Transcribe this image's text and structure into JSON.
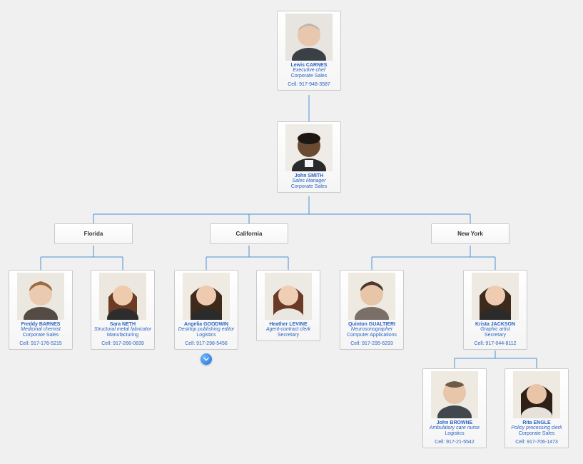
{
  "root": {
    "name": "Lewis CARNES",
    "role": "Executive chef",
    "dept": "Corporate Sales",
    "cell": "Cell: 917-948-3587"
  },
  "manager": {
    "name": "John SMITH",
    "role": "Sales Manager",
    "dept": "Corporate Sales"
  },
  "regions": {
    "florida": {
      "label": "Florida"
    },
    "california": {
      "label": "California"
    },
    "newyork": {
      "label": "New York"
    }
  },
  "people": {
    "freddy": {
      "name": "Freddy BARNES",
      "role": "Medicinal chemist",
      "dept": "Corporate Sales",
      "cell": "Cell: 917-176-5215"
    },
    "sara": {
      "name": "Sara NETH",
      "role": "Structural metal fabricator",
      "dept": "Manufacturing",
      "cell": "Cell: 917-266-0839"
    },
    "angelia": {
      "name": "Angelia GOODWIN",
      "role": "Desktop publishing editor",
      "dept": "Logistics",
      "cell": "Cell: 917-298-5456"
    },
    "heather": {
      "name": "Heather LEVINE",
      "role": "Agent-contract clerk",
      "dept": "Secretary"
    },
    "quinton": {
      "name": "Quinton GUALTIERI",
      "role": "Neurosonographer",
      "dept": "Computer Applications",
      "cell": "Cell: 917-295-6293"
    },
    "krista": {
      "name": "Krista JACKSON",
      "role": "Graphic artist",
      "dept": "Secretary",
      "cell": "Cell: 917-044-8112"
    },
    "john": {
      "name": "John BROWNE",
      "role": "Ambulatory care nurse",
      "dept": "Logistics",
      "cell": "Cell: 917-21-5542"
    },
    "rita": {
      "name": "Rita ENGLE",
      "role": "Policy processing clerk",
      "dept": "Corporate Sales",
      "cell": "Cell: 917-706-1473"
    }
  },
  "chart_data": {
    "type": "org-chart",
    "root": {
      "name": "Lewis CARNES",
      "role": "Executive chef",
      "dept": "Corporate Sales",
      "cell": "917-948-3587",
      "children": [
        {
          "name": "John SMITH",
          "role": "Sales Manager",
          "dept": "Corporate Sales",
          "children": [
            {
              "region": "Florida",
              "children": [
                {
                  "name": "Freddy BARNES",
                  "role": "Medicinal chemist",
                  "dept": "Corporate Sales",
                  "cell": "917-176-5215"
                },
                {
                  "name": "Sara NETH",
                  "role": "Structural metal fabricator",
                  "dept": "Manufacturing",
                  "cell": "917-266-0839"
                }
              ]
            },
            {
              "region": "California",
              "children": [
                {
                  "name": "Angelia GOODWIN",
                  "role": "Desktop publishing editor",
                  "dept": "Logistics",
                  "cell": "917-298-5456",
                  "has_more": true
                },
                {
                  "name": "Heather LEVINE",
                  "role": "Agent-contract clerk",
                  "dept": "Secretary"
                }
              ]
            },
            {
              "region": "New York",
              "children": [
                {
                  "name": "Quinton GUALTIERI",
                  "role": "Neurosonographer",
                  "dept": "Computer Applications",
                  "cell": "917-295-6293"
                },
                {
                  "name": "Krista JACKSON",
                  "role": "Graphic artist",
                  "dept": "Secretary",
                  "cell": "917-044-8112",
                  "children": [
                    {
                      "name": "John BROWNE",
                      "role": "Ambulatory care nurse",
                      "dept": "Logistics",
                      "cell": "917-21-5542"
                    },
                    {
                      "name": "Rita ENGLE",
                      "role": "Policy processing clerk",
                      "dept": "Corporate Sales",
                      "cell": "917-706-1473"
                    }
                  ]
                }
              ]
            }
          ]
        }
      ]
    }
  }
}
